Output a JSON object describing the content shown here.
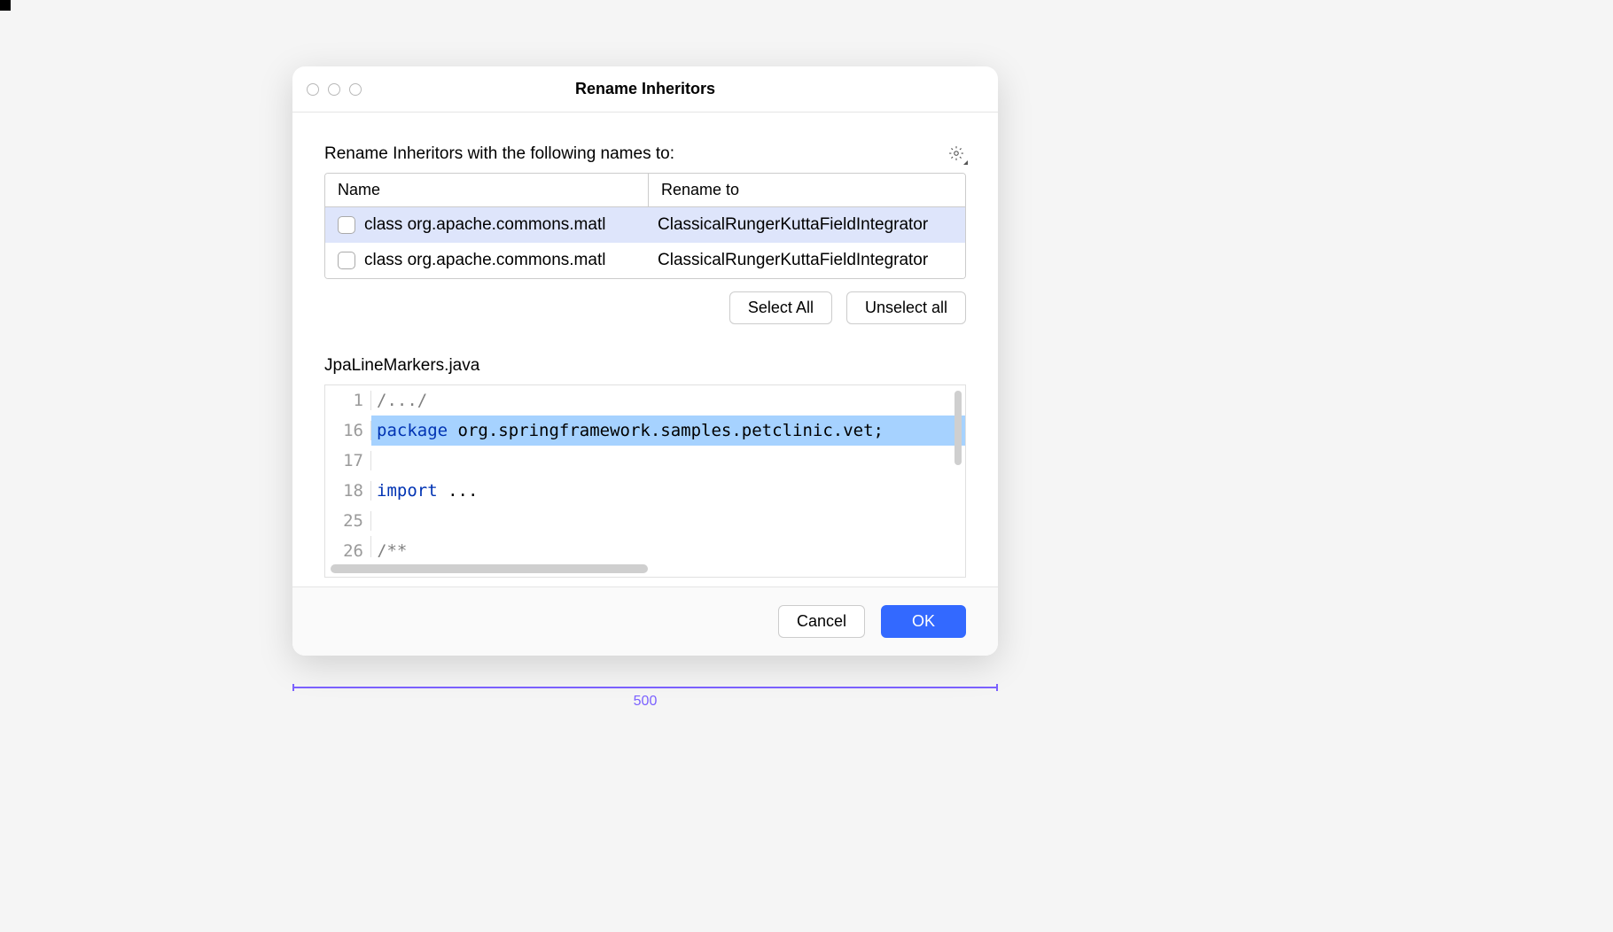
{
  "dialog": {
    "title": "Rename Inheritors",
    "prompt": "Rename Inheritors with the following names to:",
    "columns": {
      "name": "Name",
      "rename_to": "Rename to"
    },
    "rows": [
      {
        "name": "class org.apache.commons.matl",
        "rename_to": "ClassicalRungerKuttaFieldIntegrator",
        "selected": true
      },
      {
        "name": "class org.apache.commons.matl",
        "rename_to": "ClassicalRungerKuttaFieldIntegrator",
        "selected": false
      }
    ],
    "buttons": {
      "select_all": "Select All",
      "unselect_all": "Unselect all"
    },
    "filename": "JpaLineMarkers.java",
    "code": {
      "lines": [
        {
          "num": "1",
          "text": "/.../",
          "type": "comment"
        },
        {
          "num": "16",
          "kw": "package",
          "rest": " org.springframework.samples.petclinic.vet;",
          "highlighted": true
        },
        {
          "num": "17",
          "text": "",
          "type": "plain"
        },
        {
          "num": "18",
          "kw": "import",
          "rest": " ...",
          "type": "plain"
        },
        {
          "num": "25",
          "text": "",
          "type": "plain"
        },
        {
          "num": "26",
          "text": "/**",
          "type": "comment",
          "partial": true
        }
      ]
    },
    "footer": {
      "cancel": "Cancel",
      "ok": "OK"
    }
  },
  "ruler": {
    "value": "500"
  }
}
